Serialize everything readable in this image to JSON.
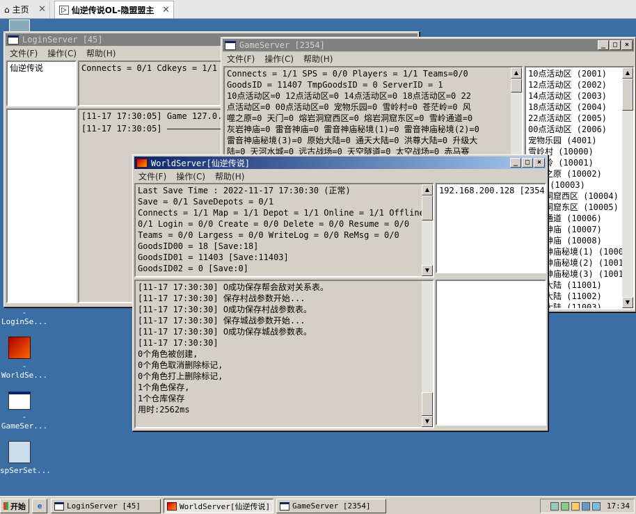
{
  "browser": {
    "tabs": [
      {
        "label": "主页"
      },
      {
        "label": "仙逆传说OL-隐盟盟主"
      }
    ]
  },
  "desktop": {
    "icons": [
      {
        "label": "-LoginSe..."
      },
      {
        "label": "-WorldSe..."
      },
      {
        "label": "-GameSer..."
      },
      {
        "label": "spSerSet..."
      }
    ]
  },
  "login": {
    "title": "LoginServer [45]",
    "menu": [
      "文件(F)",
      "操作(C)",
      "帮助(H)"
    ],
    "server_name": "仙逆传说",
    "status": "Connects = 0/1  Cdkeys = 1/1  P",
    "log": [
      "[11-17 17:30:05]  Game 127.0.0.",
      "[11-17 17:30:05] ———————————"
    ]
  },
  "game": {
    "title": "GameServer [2354]",
    "menu": [
      "文件(F)",
      "操作(C)",
      "帮助(H)"
    ],
    "stats": [
      "Connects = 1/1 SPS = 0/0 Players = 1/1  Teams=0/0",
      "GoodsID = 11407  TmpGoodsID = 0  ServerID = 1",
      "10点活动区=0 12点活动区=0 14点活动区=0 18点活动区=0 22",
      "点活动区=0 00点活动区=0 宠物乐园=0 雪岭村=0 苍茫岭=0 风",
      "噬之原=0 天门=0 熔岩洞窟西区=0 熔岩洞窟东区=0 雪岭通道=0",
      "灰岩神庙=0 雷音神庙=0 雷音神庙秘境(1)=0 雷音神庙秘境(2)=0",
      "雷音神庙秘境(3)=0 原始大陆=0 通天大陆=0 洪尊大陆=0 升级大",
      "陆=0 天河水城=0 远古战场=0 天空隧道=0 太空战场=0 赤马赛"
    ],
    "regions": [
      "10点活动区 (2001)",
      "12点活动区 (2002)",
      "14点活动区 (2003)",
      "18点活动区 (2004)",
      "22点活动区 (2005)",
      "00点活动区 (2006)",
      "宠物乐园 (4001)",
      "雪岭村 (10000)",
      "苍茫岭 (10001)",
      "风噬之原 (10002)",
      "天门 (10003)",
      "熔岩洞窟西区 (10004)",
      "熔岩洞窟东区 (10005)",
      "雪岭通道 (10006)",
      "灰岩神庙 (10007)",
      "雷音神庙 (10008)",
      "雷音神庙秘境(1) (10009)",
      "雷音神庙秘境(2) (10010)",
      "雷音神庙秘境(3) (10011)",
      "原始大陆 (11001)",
      "通天大陆 (11002)",
      "洪尊大陆 (11003)"
    ]
  },
  "world": {
    "title": "WorldServer[仙逆传说]",
    "menu": [
      "文件(F)",
      "操作(C)",
      "帮助(H)"
    ],
    "stats": [
      "Last Save Time : 2022-11-17 17:30:30 (正常)",
      "Save = 0/1  SaveDepots = 0/1",
      "Connects = 1/1  Map = 1/1  Depot = 1/1  Online = 1/1  Offline =",
      "0/1  Login = 0/0  Create = 0/0  Delete = 0/0  Resume = 0/0",
      "Teams = 0/0  Largess = 0/0  WriteLog = 0/0  ReMsg = 0/0",
      "GoodsID00 = 18 [Save:18]",
      "GoodsID01 = 11403 [Save:11403]",
      "GoodsID02 = 0 [Save:0]"
    ],
    "ip": "192.168.200.128 [2354]",
    "log": [
      "[11-17 17:30:30] O成功保存帮会敌对关系表。",
      "[11-17 17:30:30] 保存村战参数开始...",
      "[11-17 17:30:30] O成功保存村战参数表。",
      "[11-17 17:30:30] 保存城战参数开始...",
      "[11-17 17:30:30] O成功保存城战参数表。",
      "[11-17 17:30:30]",
      "0个角色被创建,",
      "0个角色取消删除标记,",
      "0个角色打上删除标记,",
      "1个角色保存,",
      "1个仓库保存",
      "用时:2562ms"
    ]
  },
  "taskbar": {
    "start": "开始",
    "buttons": [
      "LoginServer [45]",
      "WorldServer[仙逆传说]",
      "GameServer [2354]"
    ],
    "clock": "17:34"
  }
}
